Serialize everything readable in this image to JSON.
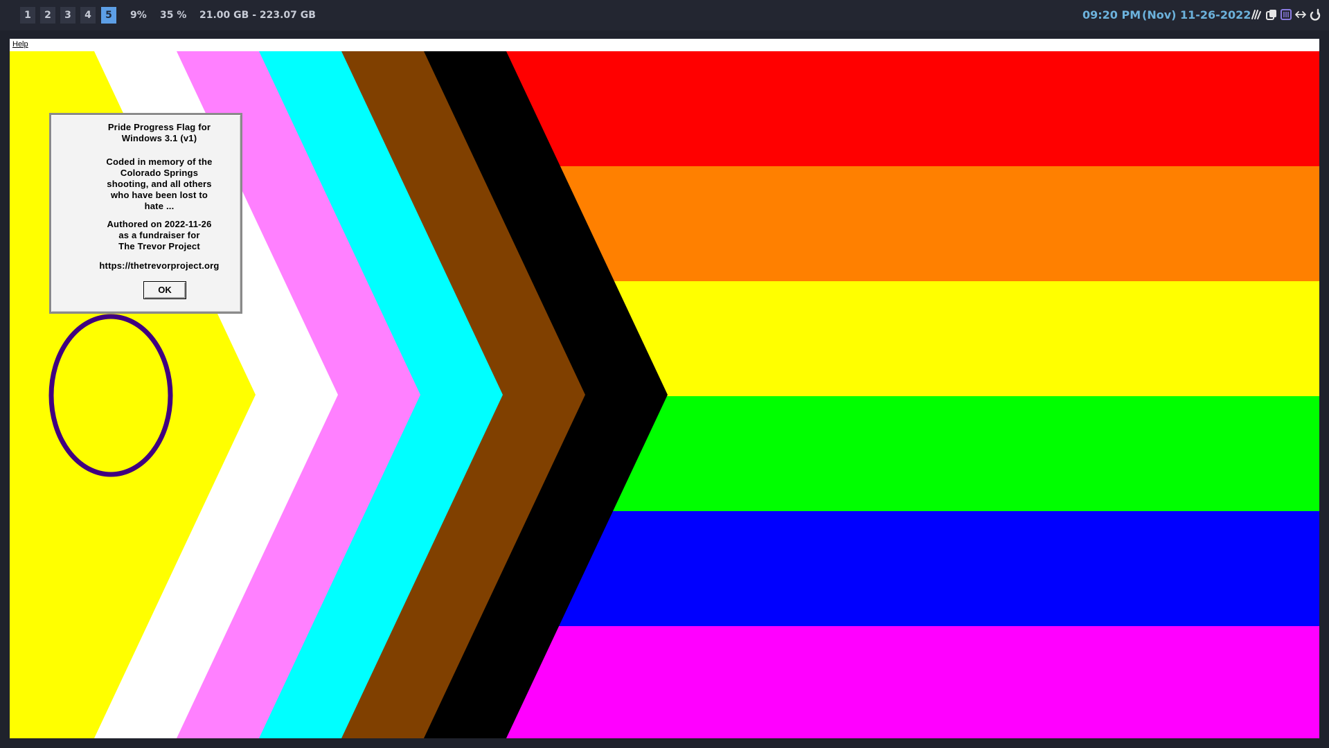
{
  "topbar": {
    "workspaces": [
      "1",
      "2",
      "3",
      "4",
      "5"
    ],
    "active_workspace": "5",
    "cpu": "9%",
    "memory": "35 %",
    "disk": "21.00 GB - 223.07 GB",
    "time": "09:20 PM",
    "date": "(Nov) 11-26-2022",
    "tray_icons": [
      "network-icon",
      "clipboard-icon",
      "battery-icon",
      "swap-icon",
      "power-icon"
    ]
  },
  "app": {
    "menu": {
      "help_label": "Help"
    },
    "flag": {
      "name": "Intersex-Inclusive Progress Pride Flag",
      "stripe_colors": [
        "#ff0000",
        "#ff8000",
        "#ffff00",
        "#00ff00",
        "#0000ff",
        "#ff00ff"
      ],
      "chevron_colors": [
        "#000000",
        "#804000",
        "#00ffff",
        "#ff80ff",
        "#ffffff"
      ],
      "intersex_field_color": "#ffff00",
      "intersex_ring_color": "#400080"
    },
    "dialog": {
      "title_line1": "Pride Progress Flag for",
      "title_line2": "Windows 3.1 (v1)",
      "memorial_line1": "Coded in memory of the",
      "memorial_line2": "Colorado Springs",
      "memorial_line3": "shooting, and all others",
      "memorial_line4": "who have been lost to",
      "memorial_line5": "hate ...",
      "authored_line1": "Authored on 2022-11-26",
      "authored_line2": "as a fundraiser for",
      "authored_line3": "The Trevor Project",
      "url": "https://thetrevorproject.org",
      "ok_label": "OK"
    }
  }
}
